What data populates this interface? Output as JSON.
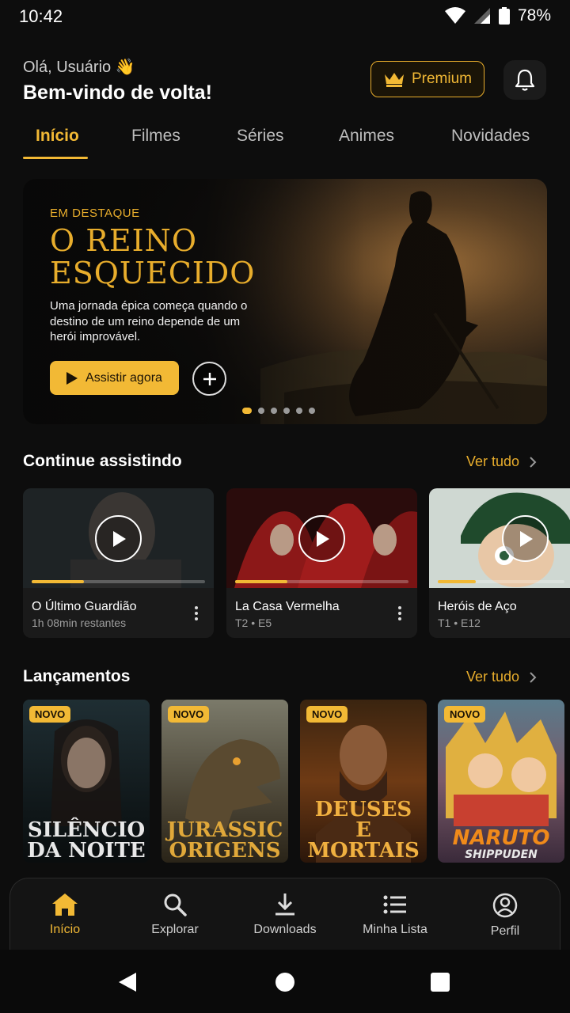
{
  "status_bar": {
    "time": "10:42",
    "battery": "78%"
  },
  "header": {
    "greeting": "Olá, Usuário 👋",
    "welcome": "Bem-vindo de volta!",
    "premium_label": "Premium"
  },
  "tabs": [
    {
      "label": "Início",
      "active": true
    },
    {
      "label": "Filmes"
    },
    {
      "label": "Séries"
    },
    {
      "label": "Animes"
    },
    {
      "label": "Novidades"
    }
  ],
  "hero": {
    "eyebrow": "EM DESTAQUE",
    "title_line1": "O REINO",
    "title_line2": "ESQUECIDO",
    "description": "Uma jornada épica começa quando o destino de um reino depende de um herói improvável.",
    "watch_label": "Assistir agora",
    "carousel_count": 6,
    "carousel_active": 0
  },
  "continue": {
    "title": "Continue assistindo",
    "see_all": "Ver tudo",
    "items": [
      {
        "title": "O Último Guardião",
        "subtitle": "1h 08min restantes",
        "progress": 0.3
      },
      {
        "title": "La Casa Vermelha",
        "subtitle": "T2 • E5",
        "progress": 0.3
      },
      {
        "title": "Heróis de Aço",
        "subtitle": "T1 • E12",
        "progress": 0.3
      }
    ]
  },
  "launches": {
    "title": "Lançamentos",
    "see_all": "Ver tudo",
    "badge": "NOVO",
    "items": [
      {
        "title_line1": "SILÊNCIO",
        "title_line2": "DA NOITE"
      },
      {
        "title_line1": "JURASSIC",
        "title_line2": "ORIGENS"
      },
      {
        "title_line1": "DEUSES",
        "title_line2": "E MORTAIS"
      },
      {
        "title_line1": "NARUTO",
        "title_line2": "SHIPPUDEN"
      }
    ]
  },
  "bottom_nav": [
    {
      "label": "Início",
      "icon": "home-icon",
      "active": true
    },
    {
      "label": "Explorar",
      "icon": "search-icon"
    },
    {
      "label": "Downloads",
      "icon": "download-icon"
    },
    {
      "label": "Minha Lista",
      "icon": "list-icon"
    },
    {
      "label": "Perfil",
      "icon": "profile-icon"
    }
  ],
  "colors": {
    "accent": "#f2b935",
    "background": "#0d0d0d"
  }
}
